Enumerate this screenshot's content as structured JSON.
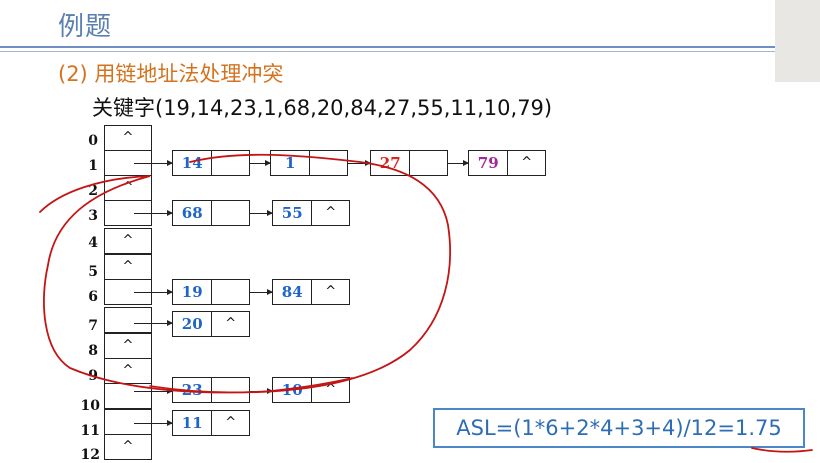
{
  "title": "例题",
  "subtitle": "(2)  用链地址法处理冲突",
  "keys_line": "关键字(19,14,23,1,68,20,84,27,55,11,10,79)",
  "table": {
    "indices": [
      "0",
      "1",
      "2",
      "3",
      "4",
      "5",
      "6",
      "7",
      "8",
      "9",
      "10",
      "11",
      "12"
    ],
    "empty_marker": "^"
  },
  "chains": [
    {
      "index": "1",
      "nodes": [
        "14",
        "1",
        "27",
        "79"
      ]
    },
    {
      "index": "3",
      "nodes": [
        "68",
        "55"
      ]
    },
    {
      "index": "6",
      "nodes": [
        "19",
        "84"
      ]
    },
    {
      "index": "7",
      "nodes": [
        "20"
      ]
    },
    {
      "index": "9",
      "nodes": [
        "23",
        "10"
      ]
    },
    {
      "index": "11",
      "nodes": [
        "11"
      ]
    }
  ],
  "asl_formula": "ASL=(1*6+2*4+3+4)/12=1.75",
  "colors": {
    "title": "#5b7fb0",
    "subtitle": "#d4731e",
    "blue_value": "#1f64c8",
    "red_value": "#d9261c",
    "purple_value": "#a0289a",
    "annotation_ink": "#c41414",
    "asl_text": "#2d6db5"
  }
}
